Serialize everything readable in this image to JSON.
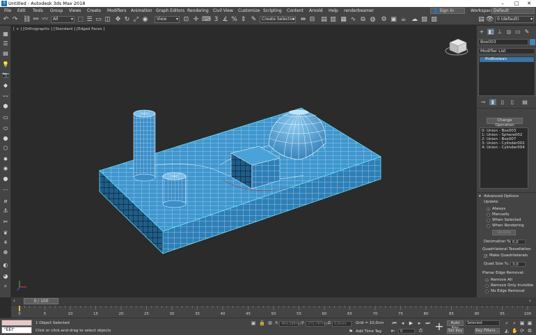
{
  "window": {
    "title": "Untitled - Autodesk 3ds Max 2018"
  },
  "menu": [
    "File",
    "Edit",
    "Tools",
    "Group",
    "Views",
    "Create",
    "Modifiers",
    "Animation",
    "Graph Editors",
    "Rendering",
    "Civil View",
    "Customize",
    "Scripting",
    "Content",
    "Arnold",
    "Help",
    "renderbeamer"
  ],
  "account": {
    "sign_in": "Sign In",
    "workspaces_label": "Workspaces:",
    "workspace_value": "Default"
  },
  "toolbar": {
    "filter_value": "All",
    "view_value": "View",
    "selection_set_value": "Create Selection Se"
  },
  "viewport": {
    "label": "[ + ] [Orthographic ] [Standard ] [Edged Faces ]"
  },
  "command_panel": {
    "layer_value": "0 (default)",
    "object_name": "Box003",
    "modifier_list_label": "Modifier List",
    "stack_item": "ProBoolean",
    "change_operation_button": "Change Operation",
    "operands": [
      "0: Union - Box003",
      "1: Union - Sphere002",
      "2: Union - Box007",
      "3: Union - Cylinder002",
      "4: Union - Cylinder004"
    ],
    "advanced_title": "Advanced Options",
    "update_label": "Update:",
    "update_options": [
      "Always",
      "Manually",
      "When Selected",
      "When Rendering"
    ],
    "update_button": "Update",
    "decimation_label": "Decimation %:",
    "decimation_value": "0,0",
    "quad_title": "Quadrilateral Tessellation",
    "make_quads_label": "Make Quadrilaterals",
    "quad_size_label": "Quad Size %:",
    "quad_size_value": "3,0",
    "planar_title": "Planar Edge Removal:",
    "planar_options": [
      "Remove All",
      "Remove Only Invisible",
      "No Edge Removal"
    ]
  },
  "timeline": {
    "frame_display": "0 / 100",
    "ticks": [
      "0",
      "5",
      "10",
      "15",
      "20",
      "25",
      "30",
      "35",
      "40",
      "45",
      "50",
      "55",
      "60",
      "65",
      "70",
      "75",
      "80",
      "85",
      "90",
      "95",
      "100"
    ]
  },
  "status": {
    "maxscript_text": "\"EEl\"",
    "selection_text": "1 Object Selected",
    "prompt_text": "Click or click-and-drag to select objects",
    "x_label": "X:",
    "x_value": "469,588mm",
    "y_label": "Y:",
    "y_value": "271,767mm",
    "z_label": "Z:",
    "z_value": "0,0mm",
    "grid_text": "Grid = 10,0cm",
    "add_time_tag": "Add Time Tag",
    "frame_value": "0",
    "auto_key": "Auto Key",
    "set_key": "Set Key",
    "selected_value": "Selected",
    "key_filters": "Key Filters..."
  },
  "colors": {
    "mesh_face": "#3f97cf",
    "mesh_edge": "#ffffff",
    "selection_outline": "#67e8ff",
    "viewport_bg": "#2b2b2b",
    "ui_bg": "#444444",
    "accent": "#1c6fb5"
  }
}
